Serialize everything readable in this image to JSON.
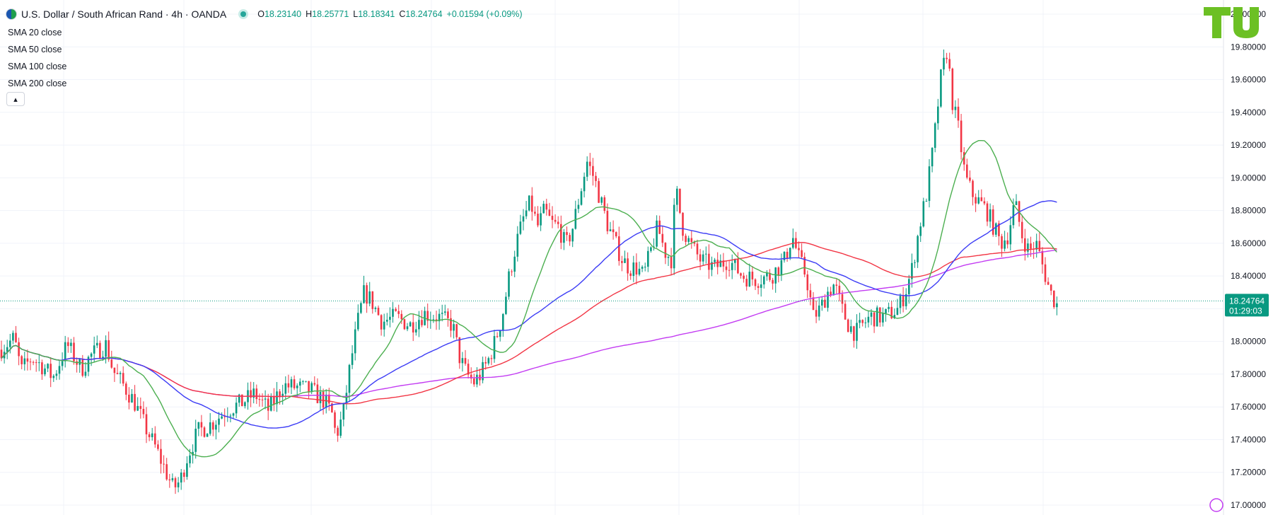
{
  "header": {
    "symbol_title": "U.S. Dollar / South African Rand · 4h · OANDA",
    "ohlc": [
      {
        "k": "O",
        "v": "18.23140"
      },
      {
        "k": "H",
        "v": "18.25771"
      },
      {
        "k": "L",
        "v": "18.18341"
      },
      {
        "k": "C",
        "v": "18.24764"
      },
      {
        "k": "",
        "v": "+0.01594 (+0.09%)"
      }
    ]
  },
  "indicators": [
    "SMA 20 close",
    "SMA 50 close",
    "SMA 100 close",
    "SMA 200 close"
  ],
  "collapse_icon": "chevron-up-icon",
  "logo_text": "TU",
  "colors": {
    "up": "#089981",
    "down": "#f23645",
    "sma20": "#4caf50",
    "sma50": "#3d3df5",
    "sma100": "#f23645",
    "sma200": "#c33cf2",
    "grid": "#f0f3fa",
    "price_line": "#089981",
    "logo": "#6cc024"
  },
  "chart_data": {
    "type": "candlestick",
    "title": "U.S. Dollar / South African Rand · 4h · OANDA",
    "y_ticks": [
      "17.00000",
      "17.20000",
      "17.40000",
      "17.60000",
      "17.80000",
      "18.00000",
      "18.20000",
      "18.40000",
      "18.60000",
      "18.80000",
      "19.00000",
      "19.20000",
      "19.40000",
      "19.60000",
      "19.80000",
      "20.00000"
    ],
    "ylim": [
      17.0,
      20.0
    ],
    "last_price": "18.24764",
    "countdown": "01:29:03",
    "grid": true,
    "price_path": [
      [
        0,
        17.95
      ],
      [
        20,
        18.02
      ],
      [
        30,
        17.82
      ],
      [
        45,
        17.9
      ],
      [
        60,
        17.85
      ],
      [
        75,
        17.78
      ],
      [
        95,
        17.98
      ],
      [
        115,
        17.83
      ],
      [
        130,
        17.92
      ],
      [
        150,
        17.98
      ],
      [
        160,
        17.82
      ],
      [
        175,
        17.73
      ],
      [
        190,
        17.63
      ],
      [
        205,
        17.48
      ],
      [
        220,
        17.35
      ],
      [
        235,
        17.2
      ],
      [
        245,
        17.1
      ],
      [
        255,
        17.15
      ],
      [
        265,
        17.3
      ],
      [
        280,
        17.45
      ],
      [
        300,
        17.5
      ],
      [
        320,
        17.58
      ],
      [
        340,
        17.62
      ],
      [
        360,
        17.68
      ],
      [
        380,
        17.58
      ],
      [
        400,
        17.73
      ],
      [
        420,
        17.72
      ],
      [
        440,
        17.7
      ],
      [
        460,
        17.63
      ],
      [
        470,
        17.55
      ],
      [
        475,
        17.42
      ],
      [
        485,
        17.55
      ],
      [
        495,
        17.85
      ],
      [
        505,
        18.1
      ],
      [
        515,
        18.3
      ],
      [
        525,
        18.25
      ],
      [
        540,
        18.12
      ],
      [
        560,
        18.15
      ],
      [
        580,
        18.1
      ],
      [
        600,
        18.17
      ],
      [
        620,
        18.15
      ],
      [
        640,
        18.1
      ],
      [
        650,
        17.9
      ],
      [
        660,
        17.8
      ],
      [
        670,
        17.75
      ],
      [
        680,
        17.8
      ],
      [
        690,
        17.88
      ],
      [
        700,
        18.0
      ],
      [
        710,
        18.15
      ],
      [
        720,
        18.4
      ],
      [
        730,
        18.6
      ],
      [
        740,
        18.75
      ],
      [
        750,
        18.85
      ],
      [
        760,
        18.7
      ],
      [
        770,
        18.8
      ],
      [
        780,
        18.72
      ],
      [
        790,
        18.7
      ],
      [
        800,
        18.58
      ],
      [
        810,
        18.7
      ],
      [
        820,
        18.9
      ],
      [
        830,
        19.1
      ],
      [
        840,
        19.0
      ],
      [
        850,
        18.85
      ],
      [
        860,
        18.7
      ],
      [
        870,
        18.6
      ],
      [
        880,
        18.5
      ],
      [
        890,
        18.45
      ],
      [
        900,
        18.45
      ],
      [
        910,
        18.4
      ],
      [
        920,
        18.55
      ],
      [
        930,
        18.7
      ],
      [
        940,
        18.55
      ],
      [
        950,
        18.5
      ],
      [
        955,
        18.95
      ],
      [
        965,
        18.7
      ],
      [
        975,
        18.6
      ],
      [
        990,
        18.5
      ],
      [
        1010,
        18.45
      ],
      [
        1030,
        18.5
      ],
      [
        1050,
        18.4
      ],
      [
        1070,
        18.38
      ],
      [
        1090,
        18.4
      ],
      [
        1110,
        18.5
      ],
      [
        1120,
        18.65
      ],
      [
        1130,
        18.5
      ],
      [
        1140,
        18.4
      ],
      [
        1150,
        18.15
      ],
      [
        1160,
        18.2
      ],
      [
        1170,
        18.3
      ],
      [
        1180,
        18.35
      ],
      [
        1190,
        18.2
      ],
      [
        1200,
        18.1
      ],
      [
        1210,
        18.05
      ],
      [
        1230,
        18.15
      ],
      [
        1250,
        18.15
      ],
      [
        1270,
        18.2
      ],
      [
        1280,
        18.3
      ],
      [
        1290,
        18.45
      ],
      [
        1300,
        18.7
      ],
      [
        1310,
        18.9
      ],
      [
        1320,
        19.2
      ],
      [
        1330,
        19.6
      ],
      [
        1340,
        19.8
      ],
      [
        1345,
        19.5
      ],
      [
        1355,
        19.3
      ],
      [
        1365,
        19.0
      ],
      [
        1375,
        18.9
      ],
      [
        1385,
        18.85
      ],
      [
        1395,
        18.8
      ],
      [
        1405,
        18.7
      ],
      [
        1415,
        18.6
      ],
      [
        1425,
        18.65
      ],
      [
        1435,
        18.85
      ],
      [
        1445,
        18.65
      ],
      [
        1455,
        18.55
      ],
      [
        1465,
        18.6
      ],
      [
        1475,
        18.45
      ],
      [
        1485,
        18.3
      ],
      [
        1495,
        18.22
      ]
    ]
  }
}
